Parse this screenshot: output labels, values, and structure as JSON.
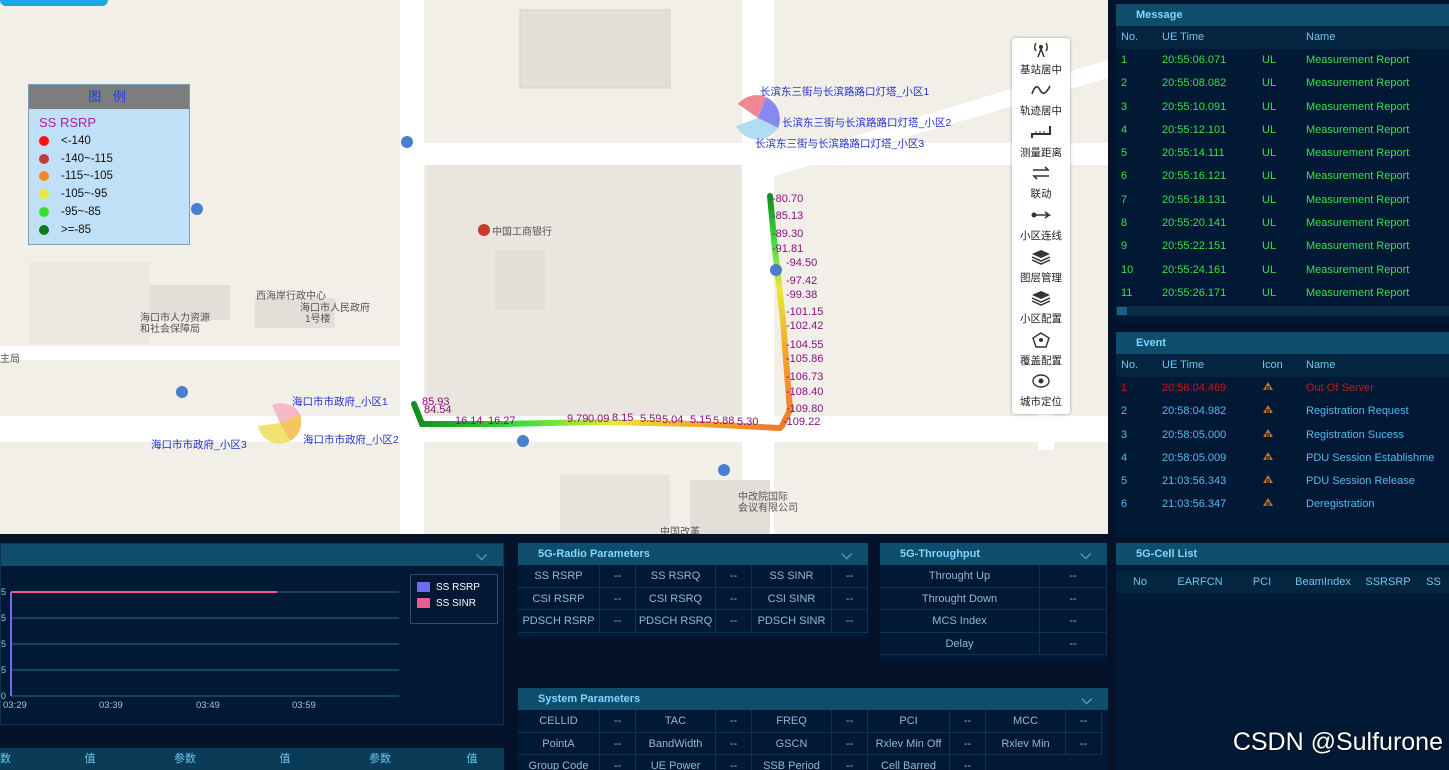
{
  "legend": {
    "title": "图 例",
    "subtitle": "SS RSRP",
    "items": [
      {
        "label": "<-140",
        "color": "#ff1010"
      },
      {
        "label": "-140~-115",
        "color": "#c53a3a"
      },
      {
        "label": "-115~-105",
        "color": "#f28a2a"
      },
      {
        "label": "-105~-95",
        "color": "#e8e83a"
      },
      {
        "label": "-95~-85",
        "color": "#33e033"
      },
      {
        "label": ">=-85",
        "color": "#0f7a1a"
      }
    ]
  },
  "map": {
    "poi_bank": "中国工商银行",
    "poi_office": "西海岸行政中心",
    "poi_hr": "海口市人力资源",
    "poi_hr2": "和社会保障局",
    "poi_gov": "海口市人民政府",
    "poi_gov2": "1号楼",
    "poi_bureau": "主局",
    "poi_conf": "中改院国际",
    "poi_conf2": "会议有限公司",
    "poi_reform": "中国改革",
    "cell_top_1": "长滨东三街与长滨路路口灯塔_小区1",
    "cell_top_2": "长滨东三街与长滨路路口灯塔_小区2",
    "cell_top_3": "长滨东三街与长滨路路口灯塔_小区3",
    "cell_left_1": "海口市市政府_小区1",
    "cell_left_2": "海口市市政府_小区2",
    "cell_left_3": "海口市市政府_小区3",
    "labels_vertical": [
      "-80.70",
      "-85.13",
      "-89.30",
      "-91.81",
      "-94.50",
      "-97.42",
      "-99.38",
      "-101.15",
      "-102.42",
      "-104.55",
      "-105.86",
      "-106.73",
      "-108.40",
      "-109.80",
      "-109.22"
    ],
    "labels_horizontal": [
      "85.93",
      "84.54",
      "16.14",
      "16.27",
      "9.79",
      "0.09",
      "8.15",
      "5.59",
      "5.04",
      "5.15",
      "5.88",
      "5.30"
    ]
  },
  "toolbar": [
    {
      "label": "基站居中",
      "icon": "antenna-icon"
    },
    {
      "label": "轨迹居中",
      "icon": "track-icon"
    },
    {
      "label": "测量距离",
      "icon": "ruler-icon"
    },
    {
      "label": "联动",
      "icon": "sync-icon"
    },
    {
      "label": "小区连线",
      "icon": "link-line-icon"
    },
    {
      "label": "图层管理",
      "icon": "layers-icon"
    },
    {
      "label": "小区配置",
      "icon": "cell-config-icon"
    },
    {
      "label": "覆盖配置",
      "icon": "coverage-icon"
    },
    {
      "label": "城市定位",
      "icon": "locate-icon"
    }
  ],
  "message": {
    "title": "Message",
    "cols": [
      "No.",
      "UE Time",
      "",
      "Name"
    ],
    "rows": [
      [
        "1",
        "20:55:06.071",
        "UL",
        "Measurement Report"
      ],
      [
        "2",
        "20:55:08.082",
        "UL",
        "Measurement Report"
      ],
      [
        "3",
        "20:55:10.091",
        "UL",
        "Measurement Report"
      ],
      [
        "4",
        "20:55:12.101",
        "UL",
        "Measurement Report"
      ],
      [
        "5",
        "20:55:14.111",
        "UL",
        "Measurement Report"
      ],
      [
        "6",
        "20:55:16.121",
        "UL",
        "Measurement Report"
      ],
      [
        "7",
        "20:55:18.131",
        "UL",
        "Measurement Report"
      ],
      [
        "8",
        "20:55:20.141",
        "UL",
        "Measurement Report"
      ],
      [
        "9",
        "20:55:22.151",
        "UL",
        "Measurement Report"
      ],
      [
        "10",
        "20:55:24.161",
        "UL",
        "Measurement Report"
      ],
      [
        "11",
        "20:55:26.171",
        "UL",
        "Measurement Report"
      ]
    ]
  },
  "event": {
    "title": "Event",
    "cols": [
      "No.",
      "UE Time",
      "Icon",
      "Name"
    ],
    "rows": [
      [
        "1",
        "20:58:04.469",
        "Out Of Server"
      ],
      [
        "2",
        "20:58:04.982",
        "Registration Request"
      ],
      [
        "3",
        "20:58:05.000",
        "Registration Sucess"
      ],
      [
        "4",
        "20:58:05.009",
        "PDU Session Establishme"
      ],
      [
        "5",
        "21:03:56.343",
        "PDU Session Release"
      ],
      [
        "6",
        "21:03:56.347",
        "Deregistration"
      ]
    ]
  },
  "chart": {
    "legend": [
      "SS RSRP",
      "SS SINR"
    ],
    "legend_colors": [
      "#6f6cf0",
      "#f05a8c"
    ],
    "x_ticks": [
      "03:29",
      "03:39",
      "03:49",
      "03:59"
    ],
    "y_ticks": [
      "5",
      "5",
      "5",
      "5",
      "0"
    ],
    "bottom_headers": [
      "数",
      "值",
      "参数",
      "值",
      "参数",
      "值"
    ]
  },
  "chart_data": {
    "type": "line",
    "x": [
      "03:29",
      "03:39",
      "03:49",
      "03:59"
    ],
    "series": [
      {
        "name": "SS RSRP",
        "values": []
      },
      {
        "name": "SS SINR",
        "values": []
      }
    ]
  },
  "radio": {
    "title": "5G-Radio Parameters",
    "cells": [
      "SS RSRP",
      "--",
      "SS RSRQ",
      "--",
      "SS SINR",
      "--",
      "CSI RSRP",
      "--",
      "CSI RSRQ",
      "--",
      "CSI SINR",
      "--",
      "PDSCH RSRP",
      "--",
      "PDSCH RSRQ",
      "--",
      "PDSCH SINR",
      "--"
    ]
  },
  "throughput": {
    "title": "5G-Throughput",
    "cells": [
      "Throught Up",
      "--",
      "Throught Down",
      "--",
      "MCS Index",
      "--",
      "Delay",
      "--"
    ]
  },
  "cell_list": {
    "title": "5G-Cell List",
    "cols": [
      "No",
      "EARFCN",
      "PCI",
      "BeamIndex",
      "SSRSRP",
      "SS"
    ]
  },
  "system": {
    "title": "System Parameters",
    "cells": [
      "CELLID",
      "--",
      "TAC",
      "--",
      "FREQ",
      "--",
      "PCI",
      "--",
      "MCC",
      "--",
      "PointA",
      "--",
      "BandWidth",
      "--",
      "GSCN",
      "--",
      "Rxlev Min Off",
      "--",
      "Rxlev Min",
      "--",
      "Group Code",
      "--",
      "UE Power",
      "--",
      "SSB Period",
      "--",
      "Cell Barred",
      "--"
    ]
  },
  "watermark": "CSDN @Sulfurone"
}
